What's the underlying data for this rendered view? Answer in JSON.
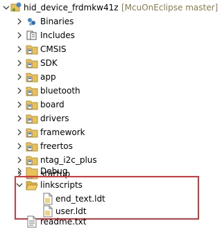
{
  "project": {
    "name": "hid_device_frdmkw41z",
    "decoration": "[McuOnEclipse master]"
  },
  "items": [
    {
      "label": "Binaries",
      "icon": "binaries-icon"
    },
    {
      "label": "Includes",
      "icon": "includes-icon"
    },
    {
      "label": "CMSIS",
      "icon": "source-folder-icon"
    },
    {
      "label": "SDK",
      "icon": "source-folder-icon"
    },
    {
      "label": "app",
      "icon": "source-folder-icon"
    },
    {
      "label": "bluetooth",
      "icon": "source-folder-icon"
    },
    {
      "label": "board",
      "icon": "source-folder-icon"
    },
    {
      "label": "drivers",
      "icon": "source-folder-icon"
    },
    {
      "label": "framework",
      "icon": "source-folder-icon"
    },
    {
      "label": "freertos",
      "icon": "source-folder-icon"
    },
    {
      "label": "ntag_i2c_plus",
      "icon": "source-folder-icon"
    },
    {
      "label": "startup",
      "icon": "source-folder-icon"
    },
    {
      "label": "Debug",
      "icon": "folder-icon"
    },
    {
      "label": "linkscripts",
      "icon": "open-folder-icon"
    },
    {
      "label": "end_text.ldt",
      "icon": "file-icon"
    },
    {
      "label": "user.ldt",
      "icon": "file-icon"
    },
    {
      "label": "readme.txt",
      "icon": "text-file-icon"
    }
  ],
  "colors": {
    "folder": "#e8c15a",
    "folder_stroke": "#b8912e",
    "highlight_border": "#d9363b",
    "decoration_text": "#8a7a4a"
  }
}
